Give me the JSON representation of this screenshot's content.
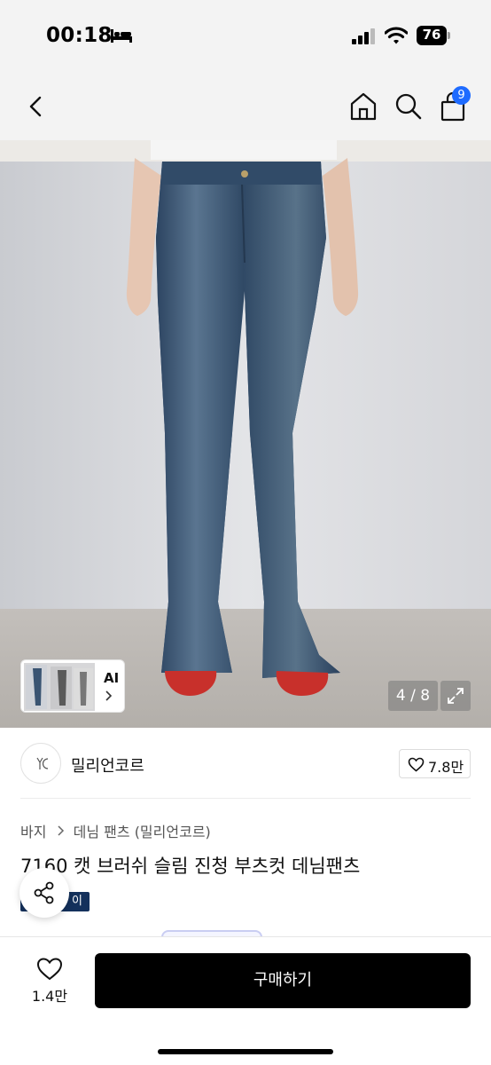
{
  "status": {
    "time": "00:18",
    "battery": "76",
    "icons": [
      "bed-icon",
      "signal-icon",
      "wifi-icon",
      "battery-icon"
    ]
  },
  "nav": {
    "icons": [
      "back-chevron-icon",
      "home-icon",
      "search-icon",
      "shopping-bag-icon"
    ],
    "cart_badge": "9"
  },
  "gallery": {
    "ai_label": "AI",
    "page_indicator": "4 / 8",
    "icons": [
      "expand-icon",
      "chevron-right-icon"
    ]
  },
  "brand": {
    "name": "밀리언코르",
    "likes": "7.8만",
    "logo_text": "YC"
  },
  "breadcrumb": {
    "items": [
      "바지",
      "데님 팬츠 (밀리언코르)"
    ]
  },
  "product": {
    "title": "7160 캣 브러쉬 슬림 진청 부츠컷 데님팬츠",
    "tag_visible": "이"
  },
  "bottom_bar": {
    "wish_count": "1.4만",
    "buy_label": "구매하기"
  },
  "colors": {
    "badge": "#1e6bff",
    "tag": "#14315c",
    "buy_button": "#000000"
  }
}
